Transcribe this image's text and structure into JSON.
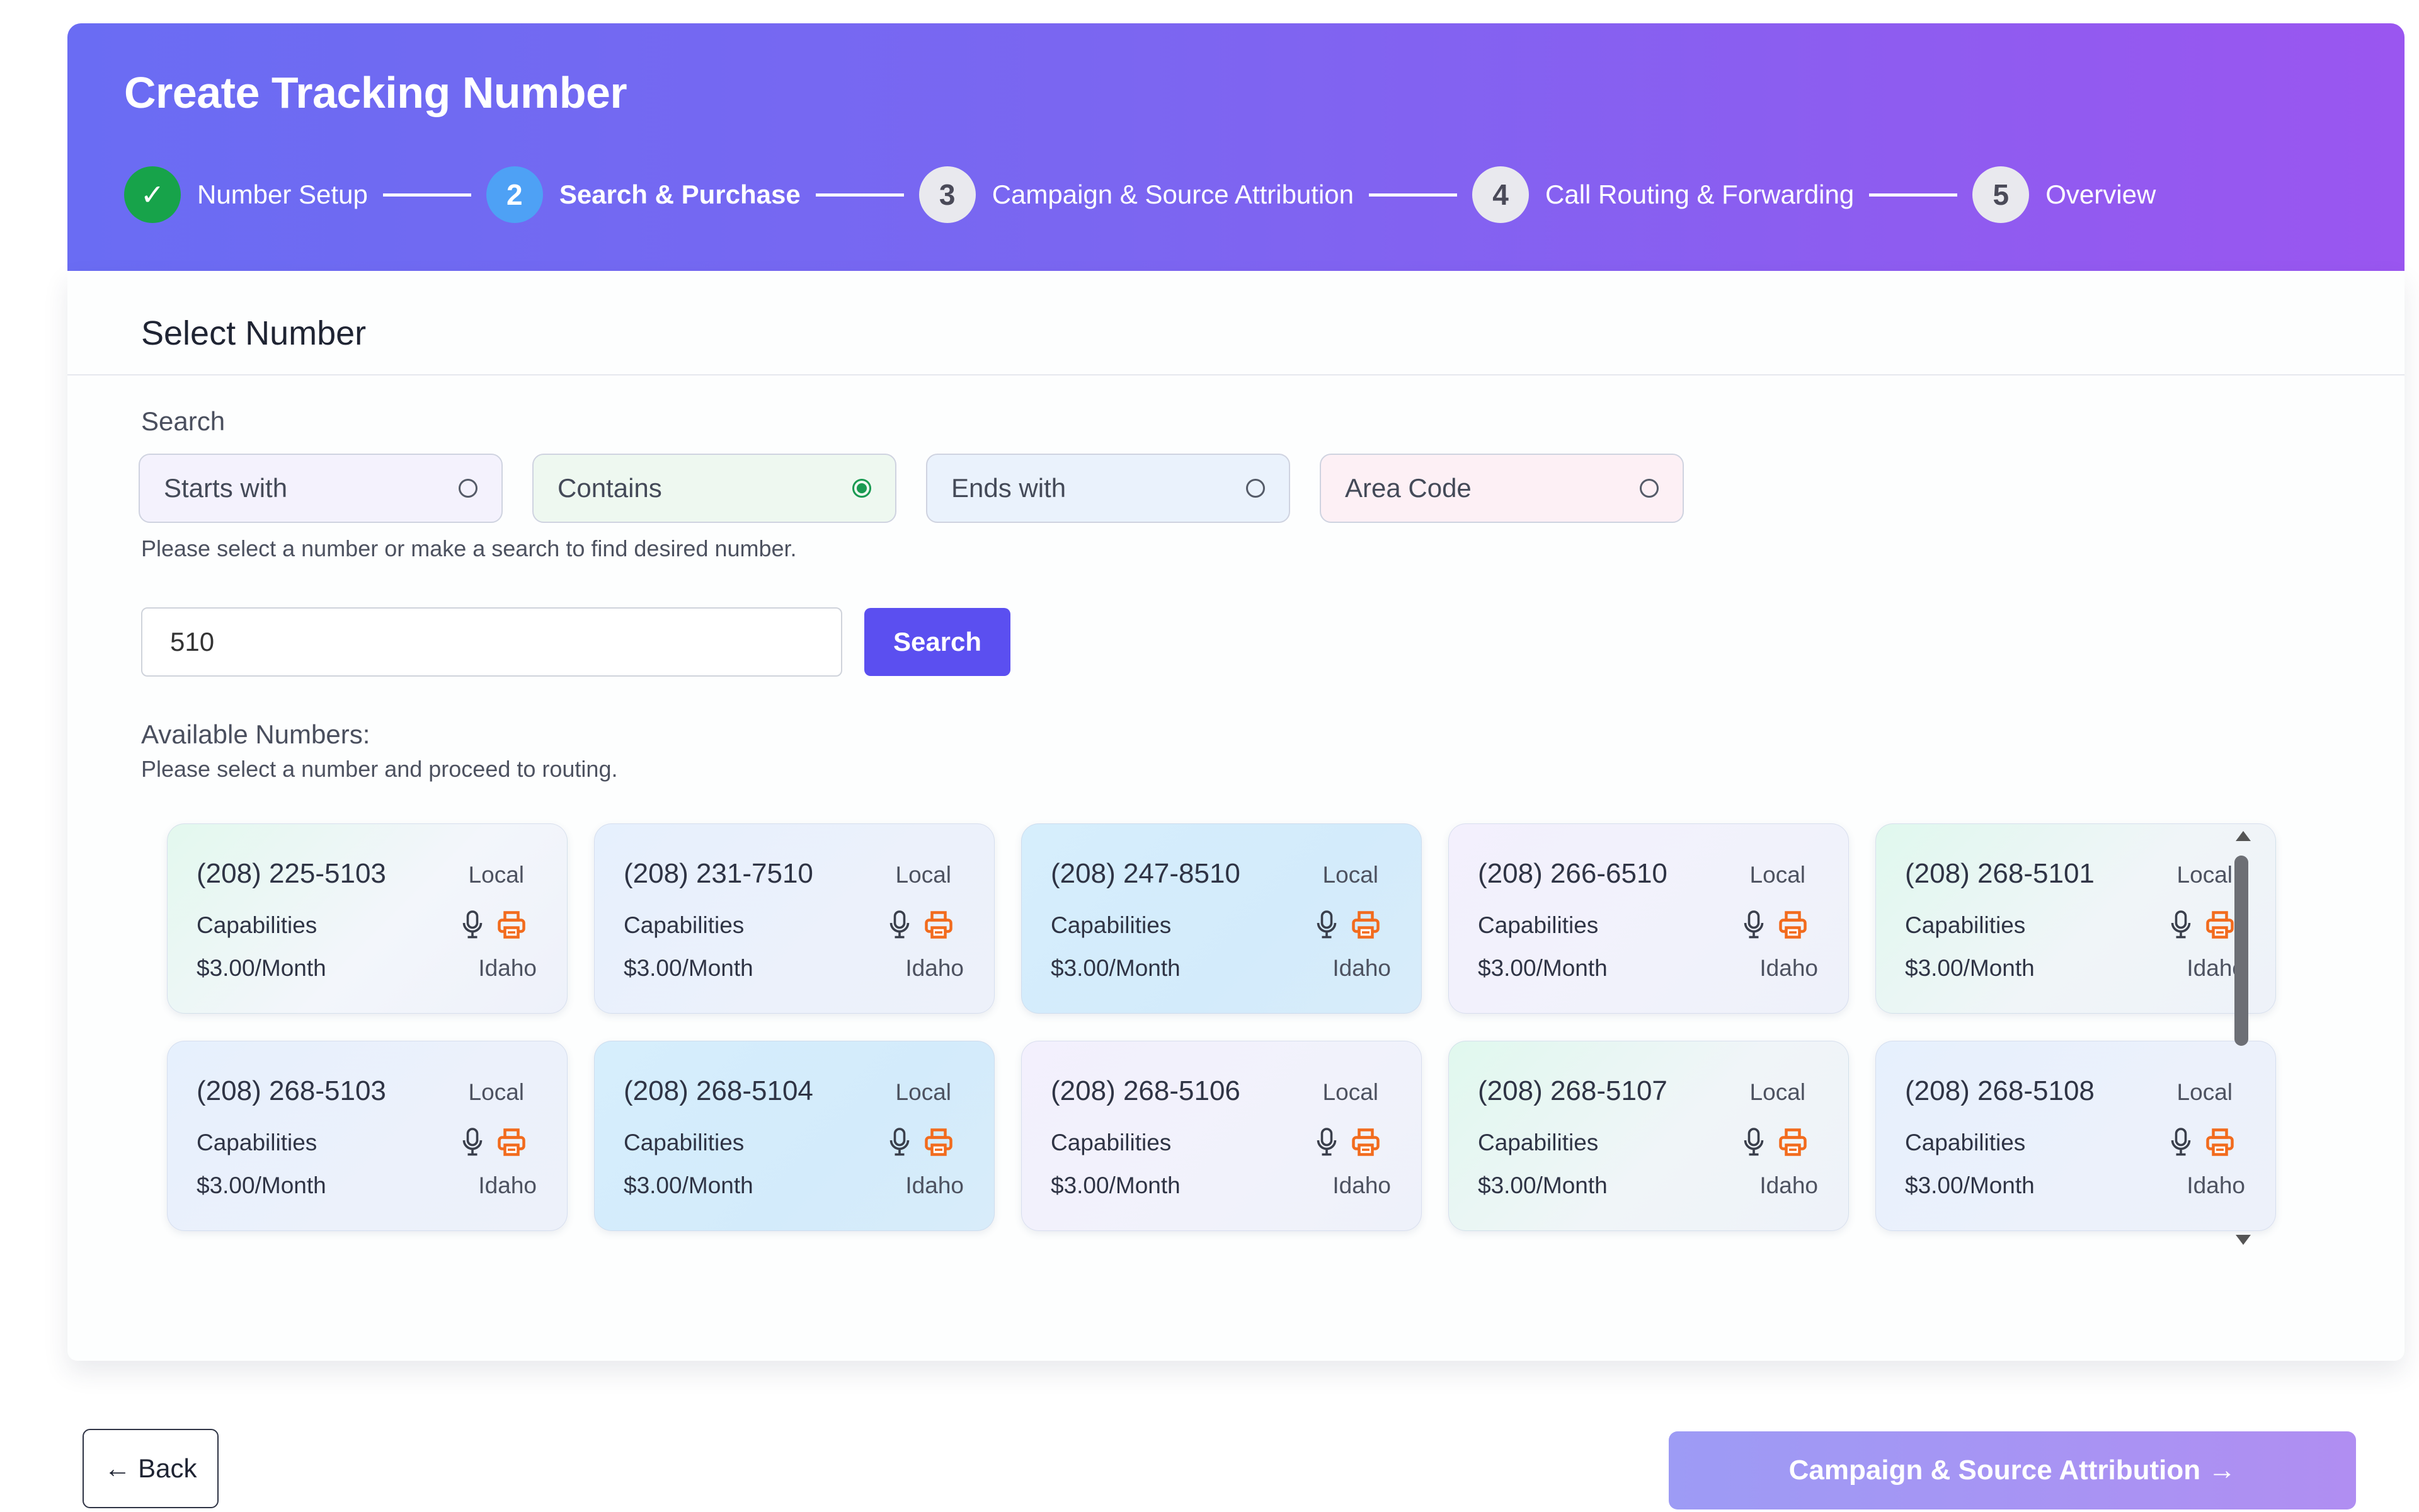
{
  "header": {
    "title": "Create Tracking Number",
    "steps": [
      {
        "number": "✓",
        "label": "Number Setup",
        "status": "done"
      },
      {
        "number": "2",
        "label": "Search & Purchase",
        "status": "active"
      },
      {
        "number": "3",
        "label": "Campaign & Source Attribution",
        "status": "pending"
      },
      {
        "number": "4",
        "label": "Call Routing & Forwarding",
        "status": "pending"
      },
      {
        "number": "5",
        "label": "Overview",
        "status": "pending"
      }
    ]
  },
  "select": {
    "title": "Select Number",
    "search_label": "Search",
    "options": [
      {
        "label": "Starts with",
        "selected": false
      },
      {
        "label": "Contains",
        "selected": true
      },
      {
        "label": "Ends with",
        "selected": false
      },
      {
        "label": "Area Code",
        "selected": false
      }
    ],
    "hint": "Please select a number or make a search to find desired number.",
    "query": "510",
    "search_button": "Search",
    "available_title": "Available Numbers:",
    "available_hint": "Please select a number and proceed to routing."
  },
  "numbers": [
    {
      "number": "(208) 225-5103",
      "type": "Local",
      "capabilities": "Capabilities",
      "price": "$3.00/Month",
      "state": "Idaho"
    },
    {
      "number": "(208) 231-7510",
      "type": "Local",
      "capabilities": "Capabilities",
      "price": "$3.00/Month",
      "state": "Idaho"
    },
    {
      "number": "(208) 247-8510",
      "type": "Local",
      "capabilities": "Capabilities",
      "price": "$3.00/Month",
      "state": "Idaho"
    },
    {
      "number": "(208) 266-6510",
      "type": "Local",
      "capabilities": "Capabilities",
      "price": "$3.00/Month",
      "state": "Idaho"
    },
    {
      "number": "(208) 268-5101",
      "type": "Local",
      "capabilities": "Capabilities",
      "price": "$3.00/Month",
      "state": "Idaho"
    },
    {
      "number": "(208) 268-5103",
      "type": "Local",
      "capabilities": "Capabilities",
      "price": "$3.00/Month",
      "state": "Idaho"
    },
    {
      "number": "(208) 268-5104",
      "type": "Local",
      "capabilities": "Capabilities",
      "price": "$3.00/Month",
      "state": "Idaho"
    },
    {
      "number": "(208) 268-5106",
      "type": "Local",
      "capabilities": "Capabilities",
      "price": "$3.00/Month",
      "state": "Idaho"
    },
    {
      "number": "(208) 268-5107",
      "type": "Local",
      "capabilities": "Capabilities",
      "price": "$3.00/Month",
      "state": "Idaho"
    },
    {
      "number": "(208) 268-5108",
      "type": "Local",
      "capabilities": "Capabilities",
      "price": "$3.00/Month",
      "state": "Idaho"
    }
  ],
  "icons": {
    "voice": "microphone-icon",
    "fax": "printer-icon",
    "check": "check-icon"
  },
  "colors": {
    "accent": "#5b4ff0",
    "done": "#17a34a",
    "active_step": "#4ea1f5",
    "fax_icon": "#f26b1d"
  },
  "footer": {
    "back_label": "← Back",
    "next_label": "Campaign & Source Attribution →"
  }
}
